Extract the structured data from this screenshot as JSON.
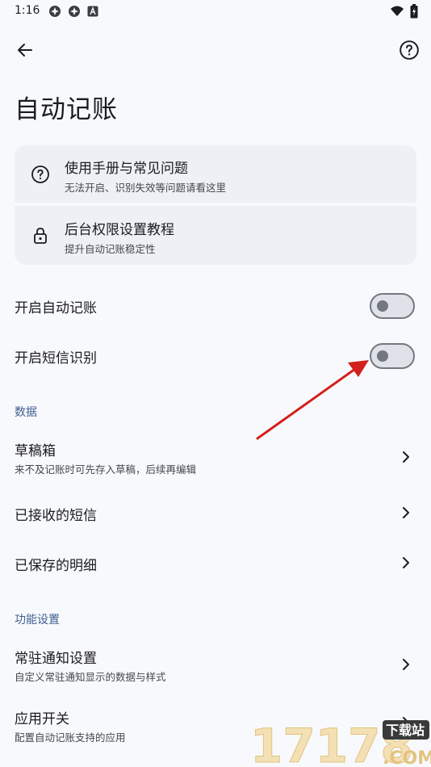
{
  "status": {
    "time": "1:16",
    "notification_icons": [
      "app-notification-icon",
      "app-notification-icon",
      "a-badge-icon"
    ],
    "system_icons": [
      "wifi-icon",
      "battery-icon"
    ]
  },
  "appbar": {
    "back_icon": "arrow-left-icon",
    "help_icon": "help-circle-icon"
  },
  "page": {
    "title": "自动记账"
  },
  "help_cards": [
    {
      "title": "使用手册与常见问题",
      "subtitle": "无法开启、识别失效等问题请看这里",
      "icon": "help-circle-icon"
    },
    {
      "title": "后台权限设置教程",
      "subtitle": "提升自动记账稳定性",
      "icon": "lock-icon"
    }
  ],
  "toggles": [
    {
      "label": "开启自动记账",
      "checked": false
    },
    {
      "label": "开启短信识别",
      "checked": false
    }
  ],
  "sections": {
    "data": {
      "title": "数据",
      "items": [
        {
          "title": "草稿箱",
          "subtitle": "来不及记账时可先存入草稿，后续再编辑"
        },
        {
          "title": "已接收的短信",
          "subtitle": ""
        },
        {
          "title": "已保存的明细",
          "subtitle": ""
        }
      ]
    },
    "features": {
      "title": "功能设置",
      "items": [
        {
          "title": "常驻通知设置",
          "subtitle": "自定义常驻通知显示的数据与样式"
        },
        {
          "title": "应用开关",
          "subtitle": "配置自动记账支持的应用"
        }
      ]
    }
  },
  "watermark": {
    "main_text": "17178",
    "badge_text": "下载站",
    "sub_text": ".COM"
  },
  "colors": {
    "background": "#f8f9fc",
    "card": "#eef0f5",
    "section": "#3d5f8f",
    "annotation_arrow": "#d3201c",
    "toggle_track": "#e0e2ea",
    "toggle_outline": "#73777f"
  }
}
